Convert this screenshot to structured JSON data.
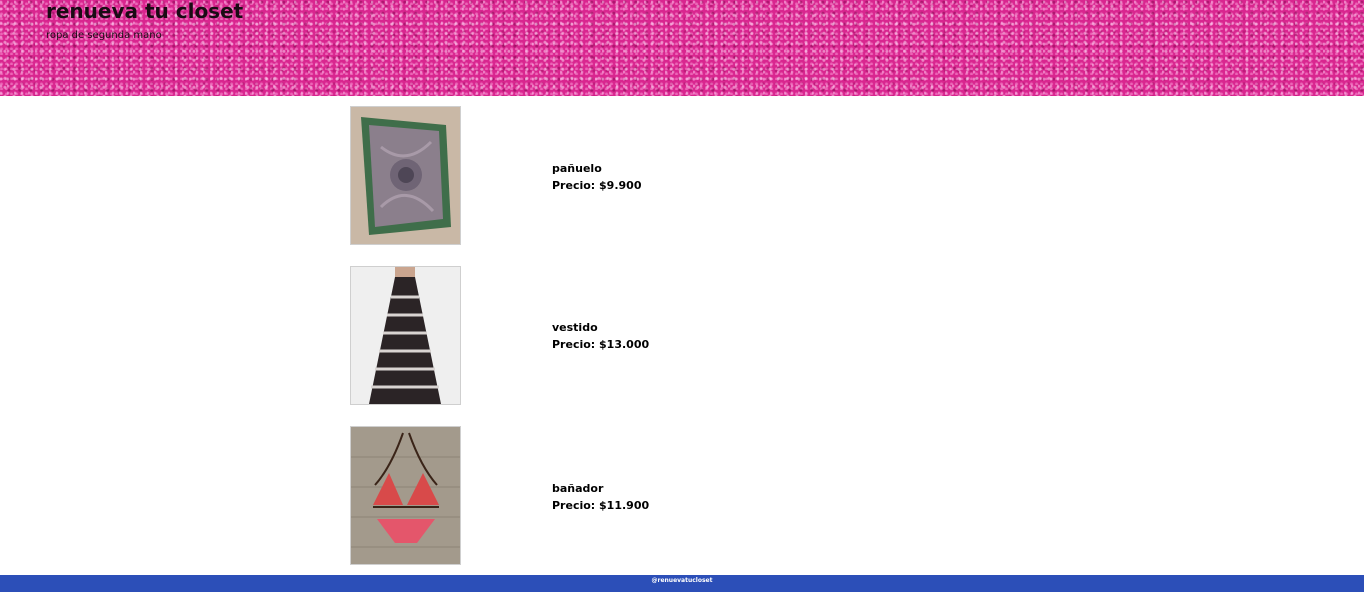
{
  "header": {
    "title": "renueva tu closet",
    "subtitle": "ropa de segunda mano"
  },
  "products": [
    {
      "name": "pañuelo",
      "price": "Precio: $9.900",
      "image_icon": "scarf-photo"
    },
    {
      "name": "vestido",
      "price": "Precio: $13.000",
      "image_icon": "dress-photo"
    },
    {
      "name": "bañador",
      "price": "Precio: $11.900",
      "image_icon": "bikini-photo"
    }
  ],
  "footer": {
    "text": "@renuevatucloset"
  },
  "colors": {
    "header_bg": "#d9268f",
    "footer_bg": "#2c4fb8"
  }
}
